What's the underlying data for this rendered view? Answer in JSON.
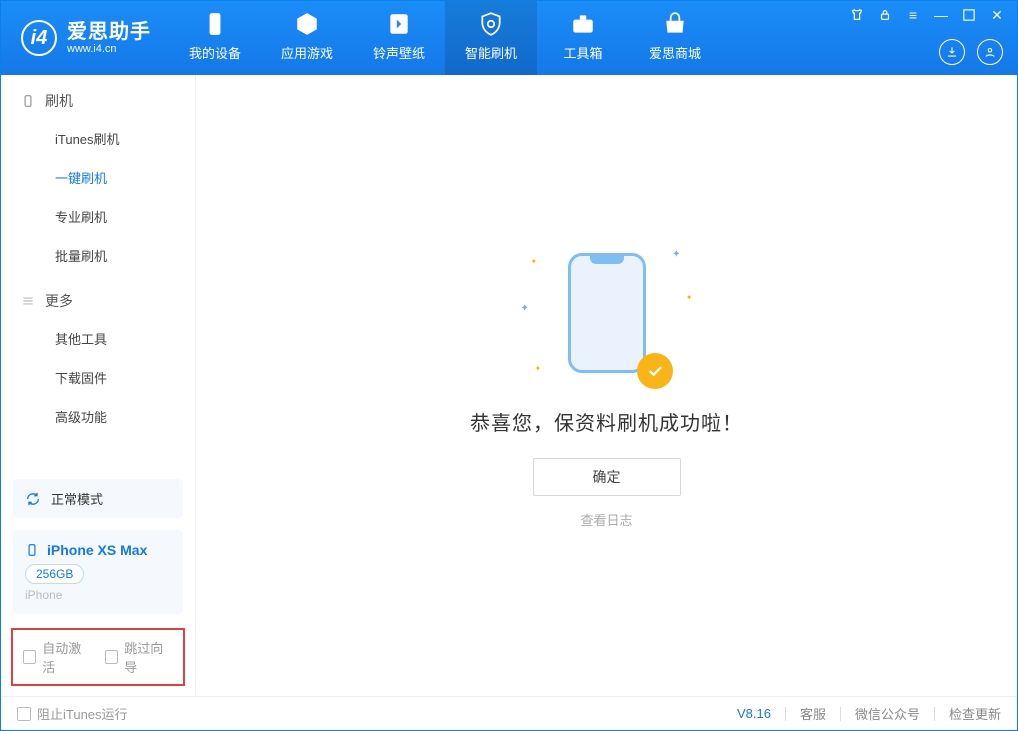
{
  "app": {
    "title": "爱思助手",
    "subtitle": "www.i4.cn"
  },
  "nav": {
    "tabs": [
      {
        "label": "我的设备"
      },
      {
        "label": "应用游戏"
      },
      {
        "label": "铃声壁纸"
      },
      {
        "label": "智能刷机"
      },
      {
        "label": "工具箱"
      },
      {
        "label": "爱思商城"
      }
    ]
  },
  "sidebar": {
    "groups": [
      {
        "title": "刷机",
        "items": [
          "iTunes刷机",
          "一键刷机",
          "专业刷机",
          "批量刷机"
        ]
      },
      {
        "title": "更多",
        "items": [
          "其他工具",
          "下载固件",
          "高级功能"
        ]
      }
    ],
    "mode_card": "正常模式",
    "device": {
      "name": "iPhone XS Max",
      "capacity": "256GB",
      "type": "iPhone"
    },
    "checks": {
      "auto_activate": "自动激活",
      "skip_guide": "跳过向导"
    }
  },
  "main": {
    "success_title": "恭喜您，保资料刷机成功啦！",
    "ok_button": "确定",
    "view_log": "查看日志"
  },
  "statusbar": {
    "block_itunes": "阻止iTunes运行",
    "version": "V8.16",
    "support": "客服",
    "wechat": "微信公众号",
    "check_update": "检查更新"
  }
}
